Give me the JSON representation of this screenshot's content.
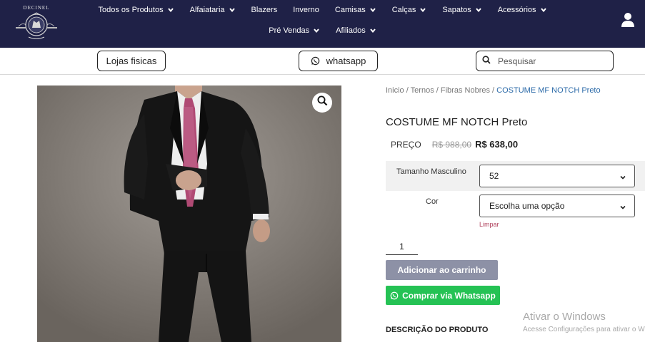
{
  "nav": {
    "logo_text": "DECINEL",
    "row1": [
      {
        "label": "Todos os Produtos",
        "dropdown": true
      },
      {
        "label": "Alfaiataria",
        "dropdown": true
      },
      {
        "label": "Blazers",
        "dropdown": false
      },
      {
        "label": "Inverno",
        "dropdown": false
      },
      {
        "label": "Camisas",
        "dropdown": true
      },
      {
        "label": "Calças",
        "dropdown": true
      },
      {
        "label": "Sapatos",
        "dropdown": true
      },
      {
        "label": "Acessórios",
        "dropdown": true
      }
    ],
    "row2": [
      {
        "label": "Pré Vendas",
        "dropdown": true
      },
      {
        "label": "Afiliados",
        "dropdown": true
      }
    ]
  },
  "subbar": {
    "lojas_label": "Lojas fisicas",
    "whatsapp_label": "whatsapp",
    "search_placeholder": "Pesquisar"
  },
  "breadcrumb": {
    "items": [
      "Inicio",
      "Ternos",
      "Fibras Nobres"
    ],
    "current": "COSTUME MF NOTCH Preto"
  },
  "product": {
    "title": "COSTUME MF NOTCH Preto",
    "price_label": "PREÇO",
    "price_old": "R$ 988,00",
    "price_new": "R$ 638,00",
    "size_label": "Tamanho Masculino",
    "size_value": "52",
    "color_label": "Cor",
    "color_value": "Escolha uma opção",
    "clear_label": "Limpar",
    "quantity": "1",
    "add_to_cart": "Adicionar ao carrinho",
    "buy_whatsapp": "Comprar via Whatsapp",
    "description_heading": "DESCRIÇÃO DO PRODUTO"
  },
  "windows": {
    "title": "Ativar o Windows",
    "subtitle": "Acesse Configurações para ativar o Windows."
  },
  "colors": {
    "nav_bg": "#1f2147",
    "whatsapp_green": "#25c254",
    "cart_button": "#8d91a6",
    "breadcrumb_current": "#2b6aa8",
    "clear_link": "#b0405c"
  },
  "icons": [
    "chevron-down-icon",
    "user-icon",
    "whatsapp-icon",
    "search-icon",
    "zoom-icon"
  ]
}
